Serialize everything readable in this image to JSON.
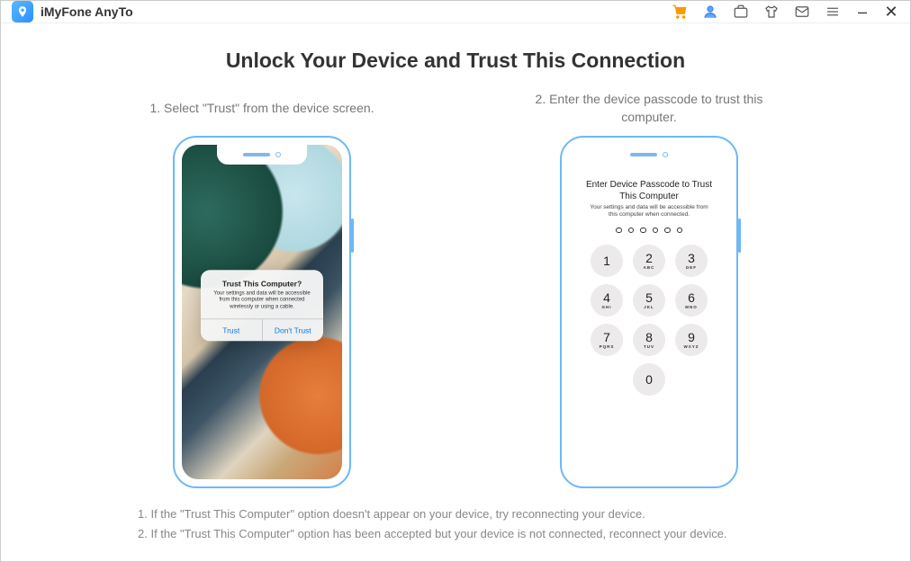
{
  "app": {
    "title": "iMyFone AnyTo"
  },
  "page": {
    "heading": "Unlock Your Device and Trust This Connection"
  },
  "step1": {
    "label": "1. Select \"Trust\" from the device screen.",
    "dialog": {
      "title": "Trust This Computer?",
      "body": "Your settings and data will be accessible from this computer when connected wirelessly or using a cable.",
      "trust": "Trust",
      "dont_trust": "Don't Trust"
    }
  },
  "step2": {
    "label": "2. Enter the device passcode to trust this computer.",
    "passcode": {
      "title": "Enter Device Passcode to Trust This Computer",
      "subtitle": "Your settings and data will be accessible from this computer when connected.",
      "keys": [
        {
          "n": "1",
          "l": ""
        },
        {
          "n": "2",
          "l": "ABC"
        },
        {
          "n": "3",
          "l": "DEF"
        },
        {
          "n": "4",
          "l": "GHI"
        },
        {
          "n": "5",
          "l": "JKL"
        },
        {
          "n": "6",
          "l": "MNO"
        },
        {
          "n": "7",
          "l": "PQRS"
        },
        {
          "n": "8",
          "l": "TUV"
        },
        {
          "n": "9",
          "l": "WXYZ"
        },
        {
          "n": "0",
          "l": ""
        }
      ]
    }
  },
  "notes": {
    "line1": "1. If the \"Trust This Computer\" option doesn't appear on your device, try reconnecting your device.",
    "line2": "2. If the \"Trust This Computer\" option has been accepted but your device is not connected, reconnect your device."
  }
}
